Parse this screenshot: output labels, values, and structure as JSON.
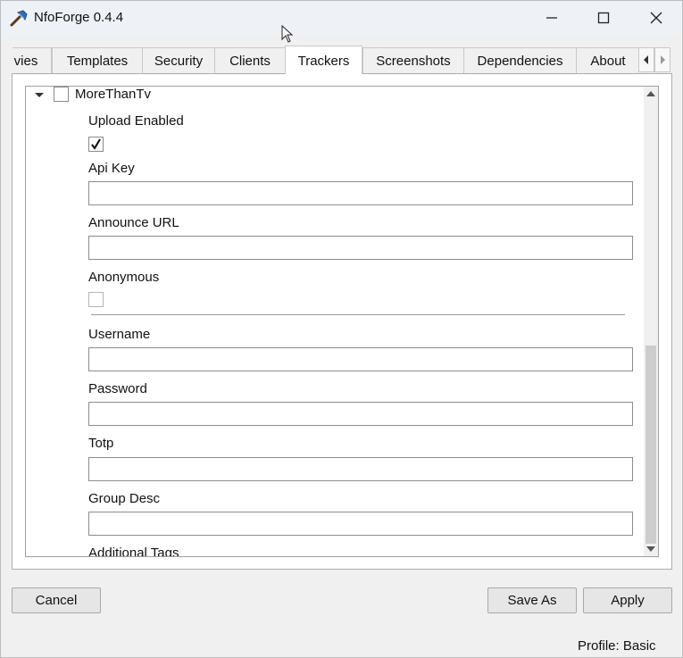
{
  "window": {
    "title": "NfoForge 0.4.4",
    "controls": [
      "minimize",
      "maximize",
      "close"
    ]
  },
  "tabs": [
    {
      "label": "vies",
      "active": false
    },
    {
      "label": "Templates",
      "active": false
    },
    {
      "label": "Security",
      "active": false
    },
    {
      "label": "Clients",
      "active": false
    },
    {
      "label": "Trackers",
      "active": true
    },
    {
      "label": "Screenshots",
      "active": false
    },
    {
      "label": "Dependencies",
      "active": false
    },
    {
      "label": "About",
      "active": false
    }
  ],
  "tracker": {
    "name": "MoreThanTv",
    "checked": false,
    "expanded": true,
    "fields": {
      "upload_enabled": {
        "label": "Upload Enabled",
        "checked": true
      },
      "api_key": {
        "label": "Api Key",
        "value": ""
      },
      "announce_url": {
        "label": "Announce URL",
        "value": ""
      },
      "anonymous": {
        "label": "Anonymous",
        "checked": false
      },
      "username": {
        "label": "Username",
        "value": ""
      },
      "password": {
        "label": "Password",
        "value": ""
      },
      "totp": {
        "label": "Totp",
        "value": ""
      },
      "group_desc": {
        "label": "Group Desc",
        "value": ""
      },
      "additional_tags": {
        "label": "Additional Tags"
      }
    }
  },
  "buttons": {
    "cancel": "Cancel",
    "save_as": "Save As",
    "apply": "Apply"
  },
  "status": {
    "profile": "Profile: Basic"
  },
  "colors": {
    "window_bg": "#f0f0f0",
    "titlebar_bg": "#eef1f6",
    "panel_bg": "#ffffff",
    "border": "#adadad"
  }
}
